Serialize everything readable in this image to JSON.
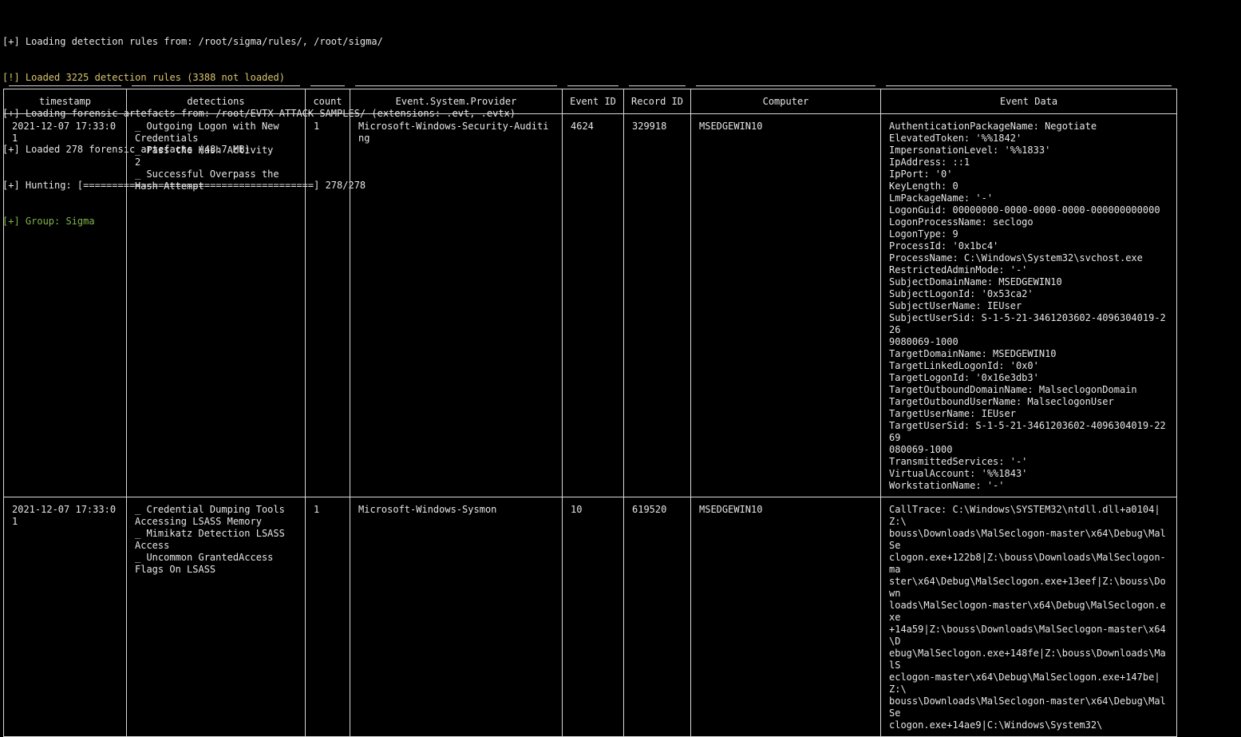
{
  "log": [
    {
      "text": "[+] Loading detection rules from: /root/sigma/rules/, /root/sigma/",
      "color": "#e6e6e6"
    },
    {
      "text": "[!] Loaded 3225 detection rules (3388 not loaded)",
      "color": "#d9c66e"
    },
    {
      "text": "[+] Loading forensic artefacts from: /root/EVTX-ATTACK-SAMPLES/ (extensions: .evt, .evtx)",
      "color": "#e6e6e6"
    },
    {
      "text": "[+] Loaded 278 forensic artefacts (48.7 MB)",
      "color": "#e6e6e6"
    },
    {
      "text": "[+] Hunting: [========================================] 278/278",
      "color": "#e6e6e6"
    },
    {
      "text": "[+] Group: Sigma",
      "color": "#7fb54a"
    }
  ],
  "table": {
    "columns": [
      "timestamp",
      "detections",
      "count",
      "Event.System.Provider",
      "Event ID",
      "Record ID",
      "Computer",
      "Event Data"
    ],
    "rows": [
      {
        "timestamp": "2021-12-07 17:33:01",
        "detections": "_ Outgoing Logon with New\nCredentials\n_ Pass the Hash Activity\n2\n_ Successful Overpass the\nHash Attempt",
        "count": "1",
        "provider": "Microsoft-Windows-Security-Auditing",
        "event_id": "4624",
        "record_id": "329918",
        "computer": "MSEDGEWIN10",
        "event_data": "AuthenticationPackageName: Negotiate\nElevatedToken: '%%1842'\nImpersonationLevel: '%%1833'\nIpAddress: ::1\nIpPort: '0'\nKeyLength: 0\nLmPackageName: '-'\nLogonGuid: 00000000-0000-0000-0000-000000000000\nLogonProcessName: seclogo\nLogonType: 9\nProcessId: '0x1bc4'\nProcessName: C:\\Windows\\System32\\svchost.exe\nRestrictedAdminMode: '-'\nSubjectDomainName: MSEDGEWIN10\nSubjectLogonId: '0x53ca2'\nSubjectUserName: IEUser\nSubjectUserSid: S-1-5-21-3461203602-4096304019-226\n9080069-1000\nTargetDomainName: MSEDGEWIN10\nTargetLinkedLogonId: '0x0'\nTargetLogonId: '0x16e3db3'\nTargetOutboundDomainName: MalseclogonDomain\nTargetOutboundUserName: MalseclogonUser\nTargetUserName: IEUser\nTargetUserSid: S-1-5-21-3461203602-4096304019-2269\n080069-1000\nTransmittedServices: '-'\nVirtualAccount: '%%1843'\nWorkstationName: '-'"
      },
      {
        "timestamp": "2021-12-07 17:33:01",
        "detections": "_ Credential Dumping Tools\nAccessing LSASS Memory\n_ Mimikatz Detection LSASS\nAccess\n_ Uncommon GrantedAccess\nFlags On LSASS",
        "count": "1",
        "provider": "Microsoft-Windows-Sysmon",
        "event_id": "10",
        "record_id": "619520",
        "computer": "MSEDGEWIN10",
        "event_data": "CallTrace: C:\\Windows\\SYSTEM32\\ntdll.dll+a0104|Z:\\\nbouss\\Downloads\\MalSeclogon-master\\x64\\Debug\\MalSe\nclogon.exe+122b8|Z:\\bouss\\Downloads\\MalSeclogon-ma\nster\\x64\\Debug\\MalSeclogon.exe+13eef|Z:\\bouss\\Down\nloads\\MalSeclogon-master\\x64\\Debug\\MalSeclogon.exe\n+14a59|Z:\\bouss\\Downloads\\MalSeclogon-master\\x64\\D\nebug\\MalSeclogon.exe+148fe|Z:\\bouss\\Downloads\\MalS\neclogon-master\\x64\\Debug\\MalSeclogon.exe+147be|Z:\\\nbouss\\Downloads\\MalSeclogon-master\\x64\\Debug\\MalSe\nclogon.exe+14ae9|C:\\Windows\\System32\\"
      }
    ]
  }
}
